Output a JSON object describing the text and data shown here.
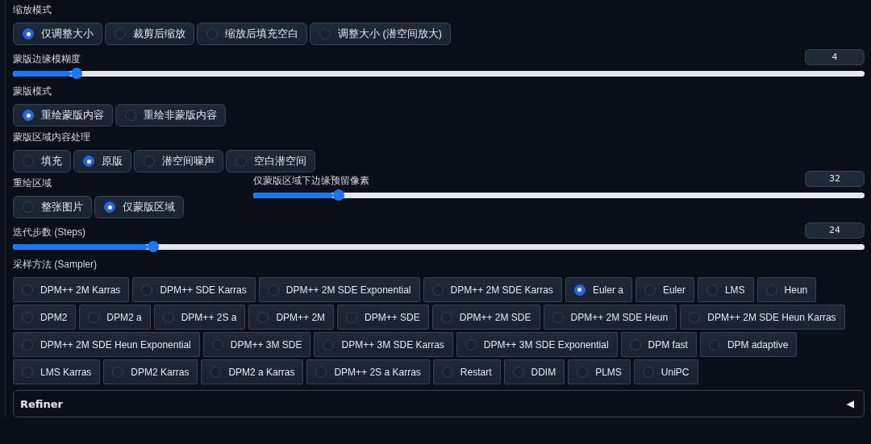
{
  "controls": [
    {
      "kind": "radio",
      "label": "缩放模式",
      "options": [
        {
          "label": "仅调整大小",
          "selected": true
        },
        {
          "label": "裁剪后缩放",
          "selected": false
        },
        {
          "label": "缩放后填充空白",
          "selected": false
        },
        {
          "label": "调整大小 (潜空间放大)",
          "selected": false
        }
      ]
    },
    {
      "kind": "slider",
      "label": "蒙版边缘模糊度",
      "value": "4",
      "level": 0.068
    },
    {
      "kind": "radio",
      "label": "蒙版模式",
      "options": [
        {
          "label": "重绘蒙版内容",
          "selected": true
        },
        {
          "label": "重绘非蒙版内容",
          "selected": false
        }
      ]
    },
    {
      "kind": "radio",
      "label": "蒙版区域内容处理",
      "options": [
        {
          "label": "填充",
          "selected": false
        },
        {
          "label": "原版",
          "selected": true
        },
        {
          "label": "潜空间噪声",
          "selected": false
        },
        {
          "label": "空白潜空间",
          "selected": false
        }
      ]
    },
    {
      "kind": "pair",
      "left": {
        "kind": "radio",
        "label": "重绘区域",
        "options": [
          {
            "label": "整张图片",
            "selected": false
          },
          {
            "label": "仅蒙版区域",
            "selected": true
          }
        ]
      },
      "right": {
        "kind": "slider",
        "label": "仅蒙版区域下边缘预留像素",
        "value": "32",
        "level": 0.13
      }
    },
    {
      "kind": "slider",
      "label": "迭代步数 (Steps)",
      "value": "24",
      "level": 0.158
    },
    {
      "kind": "radio_grid",
      "label": "采样方法 (Sampler)",
      "options": [
        {
          "label": "DPM++ 2M Karras",
          "selected": false
        },
        {
          "label": "DPM++ SDE Karras",
          "selected": false
        },
        {
          "label": "DPM++ 2M SDE Exponential",
          "selected": false
        },
        {
          "label": "DPM++ 2M SDE Karras",
          "selected": false
        },
        {
          "label": "Euler a",
          "selected": true
        },
        {
          "label": "Euler",
          "selected": false
        },
        {
          "label": "LMS",
          "selected": false
        },
        {
          "label": "Heun",
          "selected": false
        },
        {
          "label": "DPM2",
          "selected": false
        },
        {
          "label": "DPM2 a",
          "selected": false
        },
        {
          "label": "DPM++ 2S a",
          "selected": false
        },
        {
          "label": "DPM++ 2M",
          "selected": false
        },
        {
          "label": "DPM++ SDE",
          "selected": false
        },
        {
          "label": "DPM++ 2M SDE",
          "selected": false
        },
        {
          "label": "DPM++ 2M SDE Heun",
          "selected": false
        },
        {
          "label": "DPM++ 2M SDE Heun Karras",
          "selected": false
        },
        {
          "label": "DPM++ 2M SDE Heun Exponential",
          "selected": false
        },
        {
          "label": "DPM++ 3M SDE",
          "selected": false
        },
        {
          "label": "DPM++ 3M SDE Karras",
          "selected": false
        },
        {
          "label": "DPM++ 3M SDE Exponential",
          "selected": false
        },
        {
          "label": "DPM fast",
          "selected": false
        },
        {
          "label": "DPM adaptive",
          "selected": false
        },
        {
          "label": "LMS Karras",
          "selected": false
        },
        {
          "label": "DPM2 Karras",
          "selected": false
        },
        {
          "label": "DPM2 a Karras",
          "selected": false
        },
        {
          "label": "DPM++ 2S a Karras",
          "selected": false
        },
        {
          "label": "Restart",
          "selected": false
        },
        {
          "label": "DDIM",
          "selected": false
        },
        {
          "label": "PLMS",
          "selected": false
        },
        {
          "label": "UniPC",
          "selected": false
        }
      ]
    }
  ],
  "accordion": {
    "title": "Refiner",
    "toggle": "◀"
  }
}
